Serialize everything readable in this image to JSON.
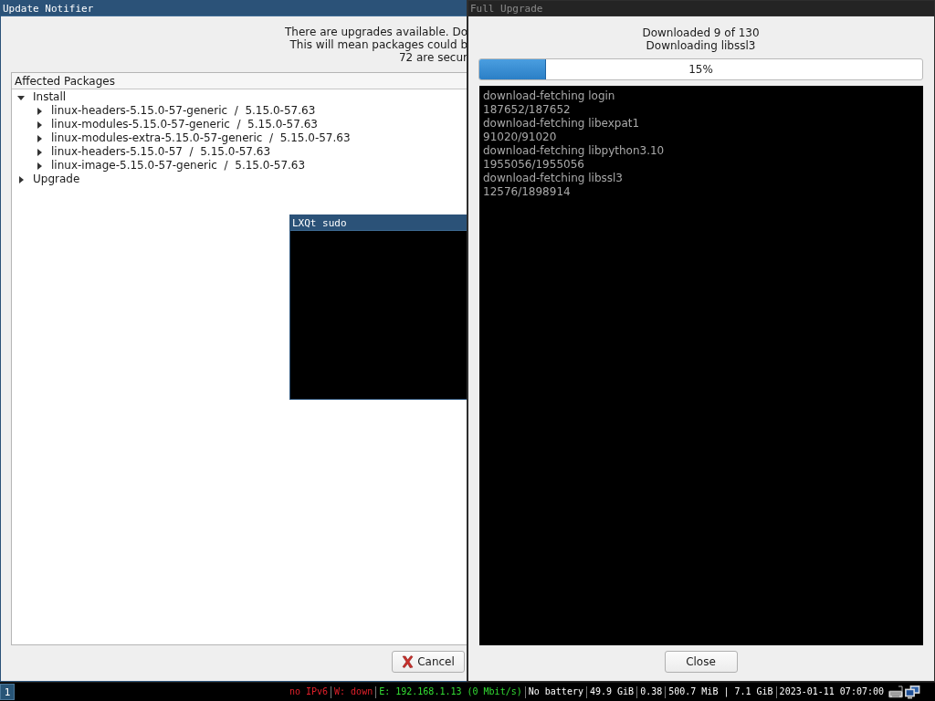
{
  "update_notifier": {
    "title": "Update Notifier",
    "focused": true,
    "message": [
      "There are upgrades available. Do",
      "This will mean packages could b",
      "72 are secur"
    ],
    "tree": {
      "header": "Affected Packages",
      "items": [
        {
          "label": "Install",
          "expanded": true,
          "children": [
            {
              "label": "linux-headers-5.15.0-57-generic  /  5.15.0-57.63",
              "expanded": false
            },
            {
              "label": "linux-modules-5.15.0-57-generic  /  5.15.0-57.63",
              "expanded": false
            },
            {
              "label": "linux-modules-extra-5.15.0-57-generic  /  5.15.0-57.63",
              "expanded": false
            },
            {
              "label": "linux-headers-5.15.0-57  /  5.15.0-57.63",
              "expanded": false
            },
            {
              "label": "linux-image-5.15.0-57-generic  /  5.15.0-57.63",
              "expanded": false
            }
          ]
        },
        {
          "label": "Upgrade",
          "expanded": false
        }
      ]
    },
    "buttons": [
      {
        "label": "Cancel"
      }
    ]
  },
  "sudo_window": {
    "title": "LXQt sudo",
    "focused": true
  },
  "full_upgrade": {
    "title": "Full Upgrade",
    "focused": false,
    "status": [
      "Downloaded 9 of 130",
      "Downloading libssl3"
    ],
    "progress": {
      "level": 0.15,
      "label": "15%"
    },
    "log": [
      "download-fetching login",
      "187652/187652",
      "download-fetching libexpat1",
      "91020/91020",
      "download-fetching libpython3.10",
      "1955056/1955056",
      "download-fetching libssl3",
      "12576/1898914"
    ],
    "buttons": [
      {
        "label": "Close"
      }
    ]
  },
  "taskbar": {
    "workspaces": [
      {
        "label": "1",
        "selected": true
      }
    ],
    "status": [
      {
        "text": "no IPv6",
        "color": "#e0202a"
      },
      {
        "text": "W: down",
        "color": "#e0202a"
      },
      {
        "text": "E: 192.168.1.13 (0 Mbit/s)",
        "color": "#33dd33"
      },
      {
        "text": "No battery",
        "color": "#ffffff"
      },
      {
        "text": "49.9 GiB",
        "color": "#ffffff"
      },
      {
        "text": "0.38",
        "color": "#ffffff"
      },
      {
        "text": "500.7 MiB | 7.1 GiB",
        "color": "#ffffff"
      },
      {
        "text": "2023-01-11 07:07:00",
        "color": "#ffffff"
      }
    ]
  }
}
